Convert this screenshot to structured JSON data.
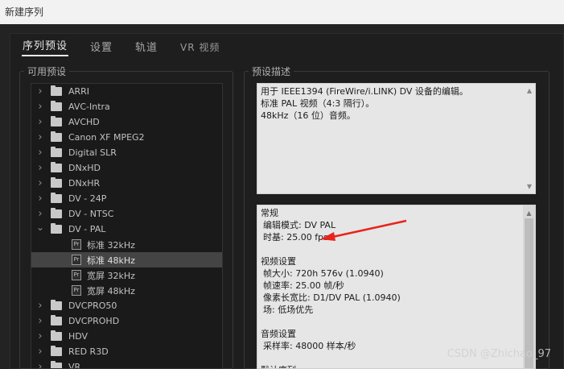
{
  "window": {
    "title": "新建序列"
  },
  "tabs": [
    {
      "label": "序列预设",
      "active": true
    },
    {
      "label": "设置",
      "active": false
    },
    {
      "label": "轨道",
      "active": false
    },
    {
      "label": "VR 视频",
      "active": false
    }
  ],
  "available_presets": {
    "title": "可用预设",
    "items": [
      {
        "label": "ARRI",
        "type": "folder",
        "expanded": false
      },
      {
        "label": "AVC-Intra",
        "type": "folder",
        "expanded": false
      },
      {
        "label": "AVCHD",
        "type": "folder",
        "expanded": false
      },
      {
        "label": "Canon XF MPEG2",
        "type": "folder",
        "expanded": false
      },
      {
        "label": "Digital SLR",
        "type": "folder",
        "expanded": false
      },
      {
        "label": "DNxHD",
        "type": "folder",
        "expanded": false
      },
      {
        "label": "DNxHR",
        "type": "folder",
        "expanded": false
      },
      {
        "label": "DV - 24P",
        "type": "folder",
        "expanded": false
      },
      {
        "label": "DV - NTSC",
        "type": "folder",
        "expanded": false
      },
      {
        "label": "DV - PAL",
        "type": "folder",
        "expanded": true
      },
      {
        "label": "标准 32kHz",
        "type": "preset"
      },
      {
        "label": "标准 48kHz",
        "type": "preset",
        "selected": true
      },
      {
        "label": "宽屏 32kHz",
        "type": "preset"
      },
      {
        "label": "宽屏 48kHz",
        "type": "preset"
      },
      {
        "label": "DVCPRO50",
        "type": "folder",
        "expanded": false
      },
      {
        "label": "DVCPROHD",
        "type": "folder",
        "expanded": false
      },
      {
        "label": "HDV",
        "type": "folder",
        "expanded": false
      },
      {
        "label": "RED R3D",
        "type": "folder",
        "expanded": false
      },
      {
        "label": "VR",
        "type": "folder",
        "expanded": false
      }
    ],
    "preset_icon_text": "Pr"
  },
  "preset_description": {
    "title": "预设描述",
    "lines": [
      "用于 IEEE1394 (FireWire/i.LINK) DV 设备的编辑。",
      "标准 PAL 视频（4:3 隔行）。",
      "48kHz（16 位）音频。"
    ]
  },
  "details": {
    "lines": [
      {
        "text": "常规",
        "indent": false
      },
      {
        "text": "编辑模式: DV PAL",
        "indent": true
      },
      {
        "text": "时基: 25.00 fps",
        "indent": true
      },
      {
        "text": "",
        "indent": false
      },
      {
        "text": "视频设置",
        "indent": false
      },
      {
        "text": "帧大小: 720h 576v (1.0940)",
        "indent": true
      },
      {
        "text": "帧速率: 25.00 帧/秒",
        "indent": true
      },
      {
        "text": "像素长宽比: D1/DV PAL (1.0940)",
        "indent": true
      },
      {
        "text": "场: 低场优先",
        "indent": true
      },
      {
        "text": "",
        "indent": false
      },
      {
        "text": "音频设置",
        "indent": false
      },
      {
        "text": "采样率: 48000 样本/秒",
        "indent": true
      },
      {
        "text": "",
        "indent": false
      },
      {
        "text": "默认序列",
        "indent": false
      }
    ]
  },
  "annotation": {
    "arrow_color": "#e8241c"
  },
  "watermark": {
    "text": "CSDN @Zhichao_97"
  }
}
